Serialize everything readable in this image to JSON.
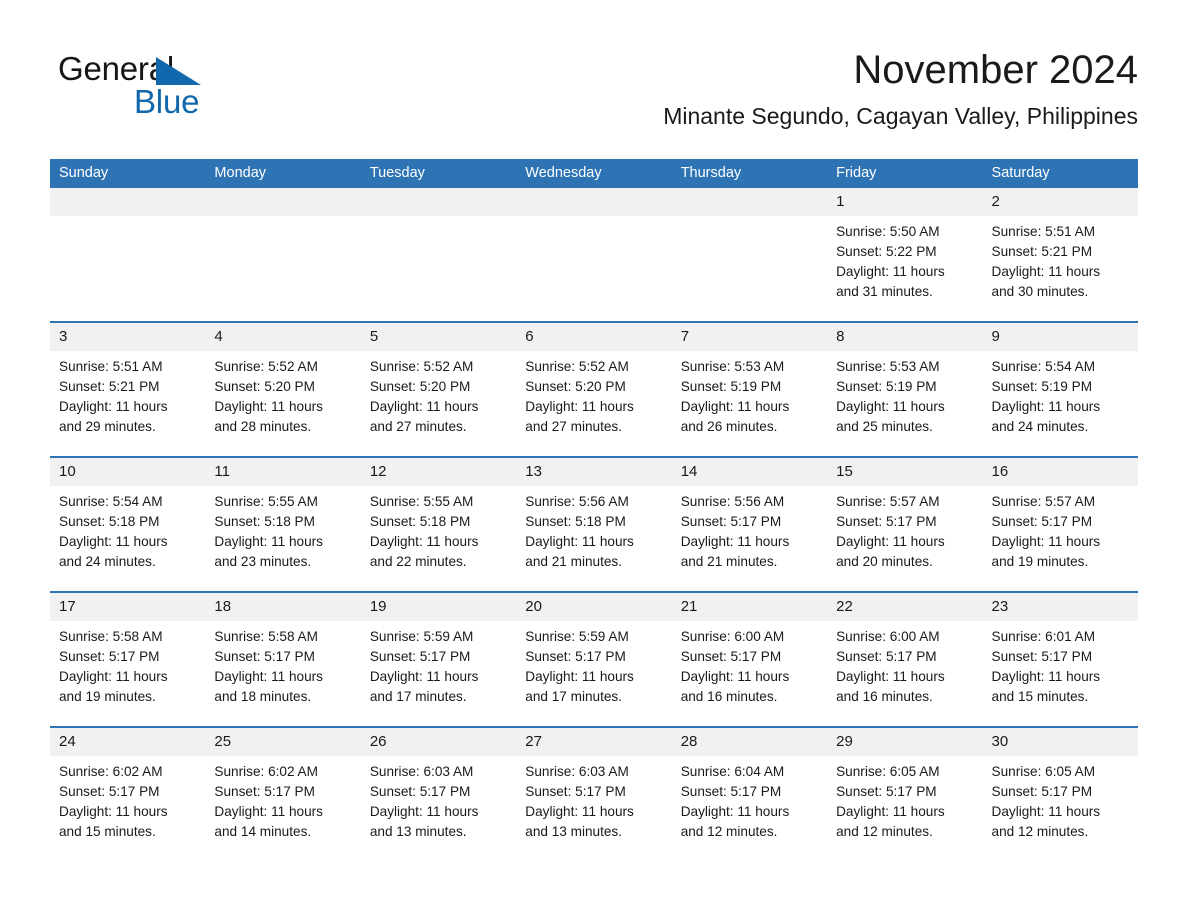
{
  "brand": {
    "name_part1": "General",
    "name_part2": "Blue",
    "triangle_color": "#1268ad"
  },
  "header": {
    "title": "November 2024",
    "subtitle": "Minante Segundo, Cagayan Valley, Philippines"
  },
  "theme": {
    "header_blue": "#2e74b5",
    "day_band_gray": "#f1f1f1",
    "text_color": "#1a1a1a"
  },
  "weekdays": [
    "Sunday",
    "Monday",
    "Tuesday",
    "Wednesday",
    "Thursday",
    "Friday",
    "Saturday"
  ],
  "weeks": [
    [
      {
        "date": "",
        "sunrise": "",
        "sunset": "",
        "daylight1": "",
        "daylight2": "",
        "empty": true
      },
      {
        "date": "",
        "sunrise": "",
        "sunset": "",
        "daylight1": "",
        "daylight2": "",
        "empty": true
      },
      {
        "date": "",
        "sunrise": "",
        "sunset": "",
        "daylight1": "",
        "daylight2": "",
        "empty": true
      },
      {
        "date": "",
        "sunrise": "",
        "sunset": "",
        "daylight1": "",
        "daylight2": "",
        "empty": true
      },
      {
        "date": "",
        "sunrise": "",
        "sunset": "",
        "daylight1": "",
        "daylight2": "",
        "empty": true
      },
      {
        "date": "1",
        "sunrise": "Sunrise: 5:50 AM",
        "sunset": "Sunset: 5:22 PM",
        "daylight1": "Daylight: 11 hours",
        "daylight2": "and 31 minutes."
      },
      {
        "date": "2",
        "sunrise": "Sunrise: 5:51 AM",
        "sunset": "Sunset: 5:21 PM",
        "daylight1": "Daylight: 11 hours",
        "daylight2": "and 30 minutes."
      }
    ],
    [
      {
        "date": "3",
        "sunrise": "Sunrise: 5:51 AM",
        "sunset": "Sunset: 5:21 PM",
        "daylight1": "Daylight: 11 hours",
        "daylight2": "and 29 minutes."
      },
      {
        "date": "4",
        "sunrise": "Sunrise: 5:52 AM",
        "sunset": "Sunset: 5:20 PM",
        "daylight1": "Daylight: 11 hours",
        "daylight2": "and 28 minutes."
      },
      {
        "date": "5",
        "sunrise": "Sunrise: 5:52 AM",
        "sunset": "Sunset: 5:20 PM",
        "daylight1": "Daylight: 11 hours",
        "daylight2": "and 27 minutes."
      },
      {
        "date": "6",
        "sunrise": "Sunrise: 5:52 AM",
        "sunset": "Sunset: 5:20 PM",
        "daylight1": "Daylight: 11 hours",
        "daylight2": "and 27 minutes."
      },
      {
        "date": "7",
        "sunrise": "Sunrise: 5:53 AM",
        "sunset": "Sunset: 5:19 PM",
        "daylight1": "Daylight: 11 hours",
        "daylight2": "and 26 minutes."
      },
      {
        "date": "8",
        "sunrise": "Sunrise: 5:53 AM",
        "sunset": "Sunset: 5:19 PM",
        "daylight1": "Daylight: 11 hours",
        "daylight2": "and 25 minutes."
      },
      {
        "date": "9",
        "sunrise": "Sunrise: 5:54 AM",
        "sunset": "Sunset: 5:19 PM",
        "daylight1": "Daylight: 11 hours",
        "daylight2": "and 24 minutes."
      }
    ],
    [
      {
        "date": "10",
        "sunrise": "Sunrise: 5:54 AM",
        "sunset": "Sunset: 5:18 PM",
        "daylight1": "Daylight: 11 hours",
        "daylight2": "and 24 minutes."
      },
      {
        "date": "11",
        "sunrise": "Sunrise: 5:55 AM",
        "sunset": "Sunset: 5:18 PM",
        "daylight1": "Daylight: 11 hours",
        "daylight2": "and 23 minutes."
      },
      {
        "date": "12",
        "sunrise": "Sunrise: 5:55 AM",
        "sunset": "Sunset: 5:18 PM",
        "daylight1": "Daylight: 11 hours",
        "daylight2": "and 22 minutes."
      },
      {
        "date": "13",
        "sunrise": "Sunrise: 5:56 AM",
        "sunset": "Sunset: 5:18 PM",
        "daylight1": "Daylight: 11 hours",
        "daylight2": "and 21 minutes."
      },
      {
        "date": "14",
        "sunrise": "Sunrise: 5:56 AM",
        "sunset": "Sunset: 5:17 PM",
        "daylight1": "Daylight: 11 hours",
        "daylight2": "and 21 minutes."
      },
      {
        "date": "15",
        "sunrise": "Sunrise: 5:57 AM",
        "sunset": "Sunset: 5:17 PM",
        "daylight1": "Daylight: 11 hours",
        "daylight2": "and 20 minutes."
      },
      {
        "date": "16",
        "sunrise": "Sunrise: 5:57 AM",
        "sunset": "Sunset: 5:17 PM",
        "daylight1": "Daylight: 11 hours",
        "daylight2": "and 19 minutes."
      }
    ],
    [
      {
        "date": "17",
        "sunrise": "Sunrise: 5:58 AM",
        "sunset": "Sunset: 5:17 PM",
        "daylight1": "Daylight: 11 hours",
        "daylight2": "and 19 minutes."
      },
      {
        "date": "18",
        "sunrise": "Sunrise: 5:58 AM",
        "sunset": "Sunset: 5:17 PM",
        "daylight1": "Daylight: 11 hours",
        "daylight2": "and 18 minutes."
      },
      {
        "date": "19",
        "sunrise": "Sunrise: 5:59 AM",
        "sunset": "Sunset: 5:17 PM",
        "daylight1": "Daylight: 11 hours",
        "daylight2": "and 17 minutes."
      },
      {
        "date": "20",
        "sunrise": "Sunrise: 5:59 AM",
        "sunset": "Sunset: 5:17 PM",
        "daylight1": "Daylight: 11 hours",
        "daylight2": "and 17 minutes."
      },
      {
        "date": "21",
        "sunrise": "Sunrise: 6:00 AM",
        "sunset": "Sunset: 5:17 PM",
        "daylight1": "Daylight: 11 hours",
        "daylight2": "and 16 minutes."
      },
      {
        "date": "22",
        "sunrise": "Sunrise: 6:00 AM",
        "sunset": "Sunset: 5:17 PM",
        "daylight1": "Daylight: 11 hours",
        "daylight2": "and 16 minutes."
      },
      {
        "date": "23",
        "sunrise": "Sunrise: 6:01 AM",
        "sunset": "Sunset: 5:17 PM",
        "daylight1": "Daylight: 11 hours",
        "daylight2": "and 15 minutes."
      }
    ],
    [
      {
        "date": "24",
        "sunrise": "Sunrise: 6:02 AM",
        "sunset": "Sunset: 5:17 PM",
        "daylight1": "Daylight: 11 hours",
        "daylight2": "and 15 minutes."
      },
      {
        "date": "25",
        "sunrise": "Sunrise: 6:02 AM",
        "sunset": "Sunset: 5:17 PM",
        "daylight1": "Daylight: 11 hours",
        "daylight2": "and 14 minutes."
      },
      {
        "date": "26",
        "sunrise": "Sunrise: 6:03 AM",
        "sunset": "Sunset: 5:17 PM",
        "daylight1": "Daylight: 11 hours",
        "daylight2": "and 13 minutes."
      },
      {
        "date": "27",
        "sunrise": "Sunrise: 6:03 AM",
        "sunset": "Sunset: 5:17 PM",
        "daylight1": "Daylight: 11 hours",
        "daylight2": "and 13 minutes."
      },
      {
        "date": "28",
        "sunrise": "Sunrise: 6:04 AM",
        "sunset": "Sunset: 5:17 PM",
        "daylight1": "Daylight: 11 hours",
        "daylight2": "and 12 minutes."
      },
      {
        "date": "29",
        "sunrise": "Sunrise: 6:05 AM",
        "sunset": "Sunset: 5:17 PM",
        "daylight1": "Daylight: 11 hours",
        "daylight2": "and 12 minutes."
      },
      {
        "date": "30",
        "sunrise": "Sunrise: 6:05 AM",
        "sunset": "Sunset: 5:17 PM",
        "daylight1": "Daylight: 11 hours",
        "daylight2": "and 12 minutes."
      }
    ]
  ]
}
